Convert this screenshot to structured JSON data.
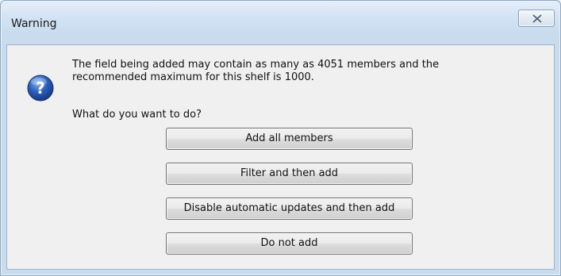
{
  "dialog": {
    "title": "Warning",
    "message_line1": "The field being added may contain as many as 4051 members and the",
    "message_line2": "recommended maximum for this shelf is 1000.",
    "prompt": "What do you want to do?",
    "icon": "question-icon",
    "buttons": [
      {
        "label": "Add all members"
      },
      {
        "label": "Filter and then add"
      },
      {
        "label": "Disable automatic updates and then add"
      },
      {
        "label": "Do not add"
      }
    ]
  },
  "colors": {
    "frame": "#c9dcee",
    "client_bg": "#f0f0f0",
    "icon_blue": "#2a5cb8"
  }
}
